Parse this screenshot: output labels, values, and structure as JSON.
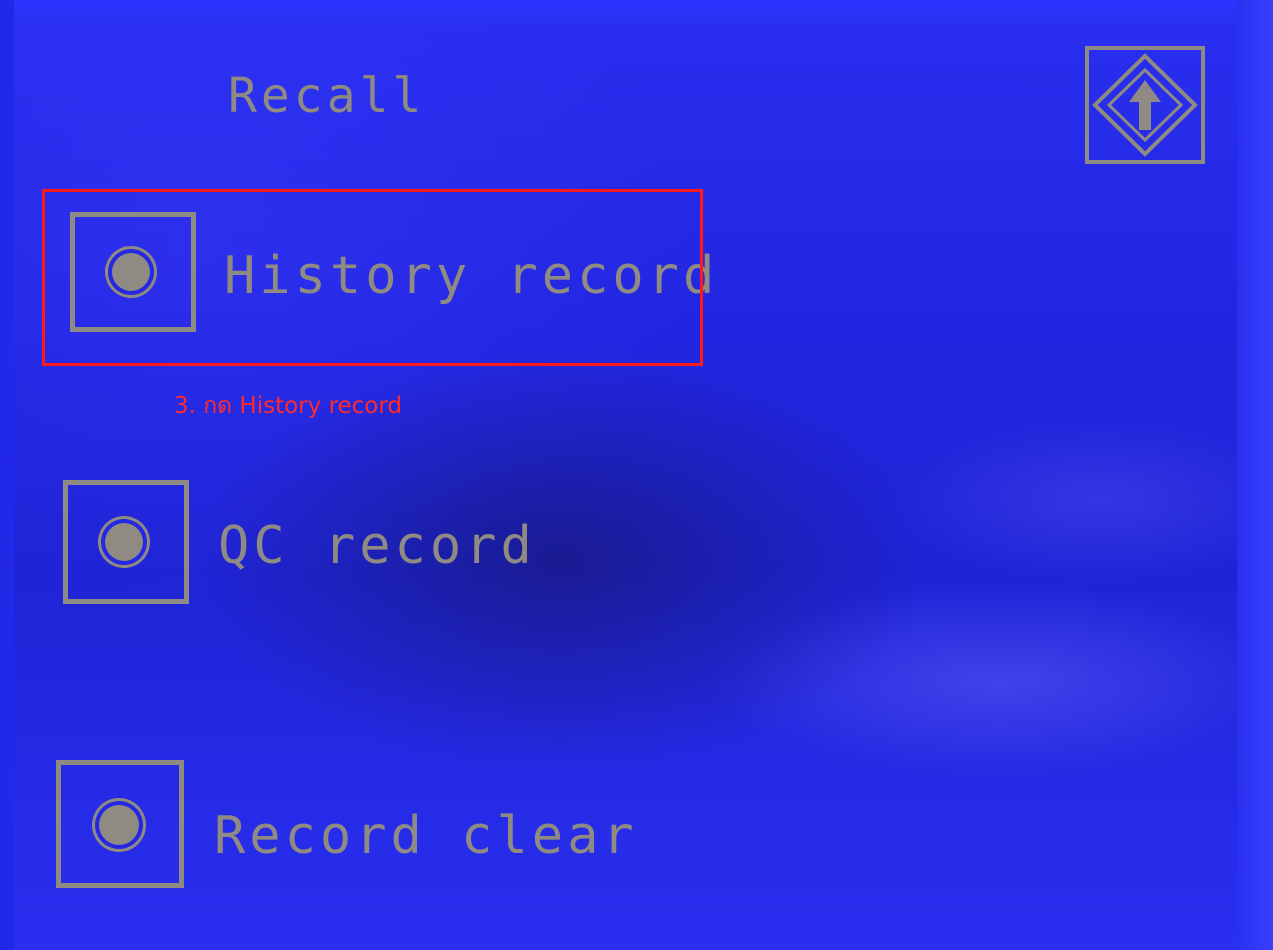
{
  "screen": {
    "title": "Recall",
    "back_button_icon": "up-arrow-icon"
  },
  "options": [
    {
      "label": "History record",
      "icon": "radio-icon"
    },
    {
      "label": "QC record",
      "icon": "radio-icon"
    },
    {
      "label": "Record clear",
      "icon": "radio-icon"
    }
  ],
  "annotation": {
    "text": "3. กด History record",
    "color": "#ff1a1a"
  },
  "colors": {
    "lcd_background": "#2226e0",
    "lcd_text": "#8f8a82"
  }
}
